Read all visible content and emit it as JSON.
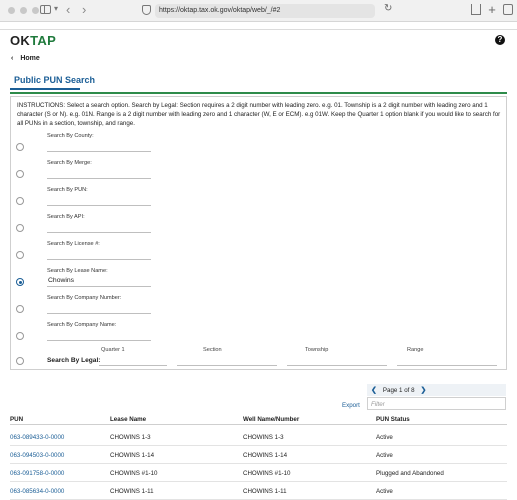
{
  "browser": {
    "url": "https://oktap.tax.ok.gov/oktap/web/_/#2"
  },
  "header": {
    "logo_ok": "OK",
    "logo_tap": "TAP",
    "help_label": "?"
  },
  "breadcrumb": {
    "home_label": "Home"
  },
  "page": {
    "title": "Public PUN Search"
  },
  "instructions": "INSTRUCTIONS: Select a search option. Search by Legal: Section requires a 2 digit number with leading zero. e.g. 01. Township is a 2 digit number with leading zero and 1 character (S or N). e.g. 01N. Range is a 2 digit number with leading zero and 1 character (W, E or ECM). e.g 01W. Keep the Quarter 1 option blank if you would like to search for all PUNs in a section, township, and range.",
  "search_fields": [
    {
      "label": "Search By County:",
      "value": "",
      "selected": false
    },
    {
      "label": "Search By Merge:",
      "value": "",
      "selected": false
    },
    {
      "label": "Search By PUN:",
      "value": "",
      "selected": false
    },
    {
      "label": "Search By API:",
      "value": "",
      "selected": false
    },
    {
      "label": "Search By License #:",
      "value": "",
      "selected": false
    },
    {
      "label": "Search By Lease Name:",
      "value": "Chowins",
      "selected": true
    },
    {
      "label": "Search By Company Number:",
      "value": "",
      "selected": false
    },
    {
      "label": "Search By Company Name:",
      "value": "",
      "selected": false
    }
  ],
  "legal": {
    "label": "Search By Legal:",
    "quarter_label": "Quarter 1",
    "section_label": "Section",
    "township_label": "Township",
    "range_label": "Range"
  },
  "results": {
    "pager_text": "Page 1 of 8",
    "filter_placeholder": "Filter",
    "export_label": "Export",
    "columns": [
      "PUN",
      "Lease Name",
      "Well Name/Number",
      "PUN Status"
    ],
    "rows": [
      {
        "pun": "063-089433-0-0000",
        "lease": "CHOWINS 1-3",
        "well": "CHOWINS 1-3",
        "status": "Active"
      },
      {
        "pun": "063-094503-0-0000",
        "lease": "CHOWINS 1-14",
        "well": "CHOWINS 1-14",
        "status": "Active"
      },
      {
        "pun": "063-091758-0-0000",
        "lease": "CHOWINS #1-10",
        "well": "CHOWINS #1-10",
        "status": "Plugged and Abandoned"
      },
      {
        "pun": "063-085634-0-0000",
        "lease": "CHOWINS 1-11",
        "well": "CHOWINS 1-11",
        "status": "Active"
      }
    ]
  },
  "colors": {
    "accent": "#1b5e96",
    "brand_green": "#2e8b4a"
  }
}
